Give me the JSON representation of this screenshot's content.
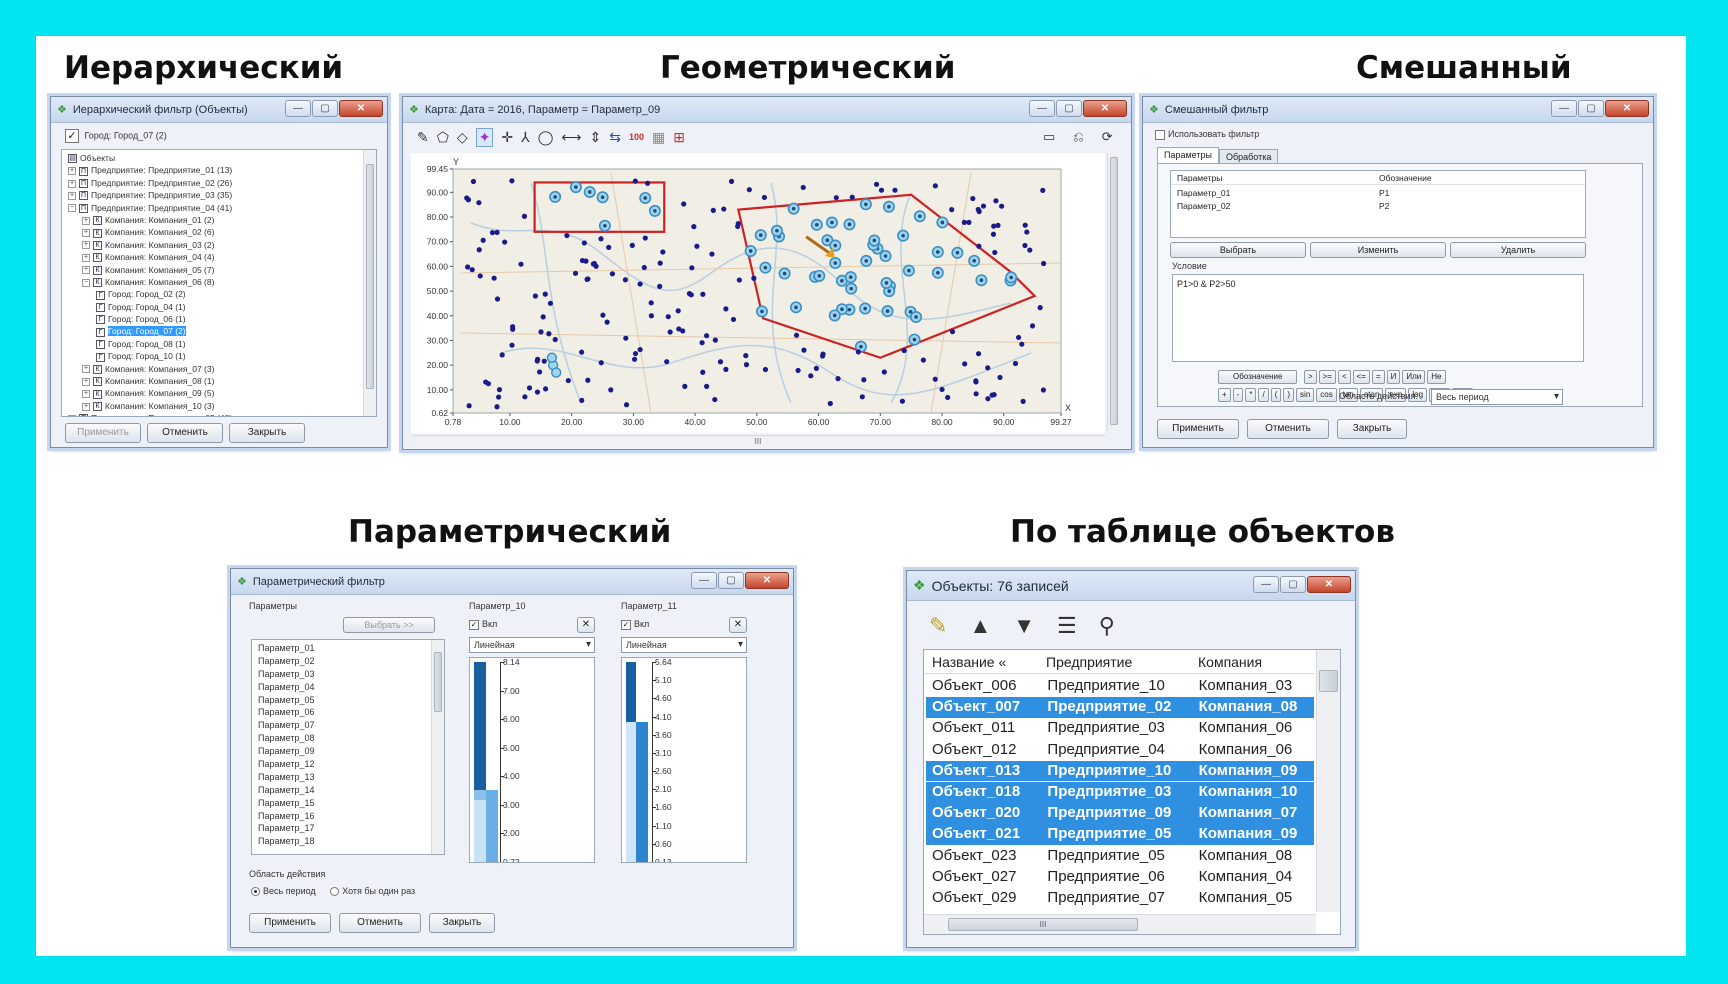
{
  "sections": {
    "hier": "Иерархический",
    "geom": "Геометрический",
    "mixed": "Смешанный",
    "param": "Параметрический",
    "table": "По таблице объектов"
  },
  "window_buttons": {
    "min": "—",
    "max": "▢",
    "close": "✕"
  },
  "hier_window": {
    "title": "Иерархический фильтр (Объекты)",
    "checked_node": "Город: Город_07 (2)",
    "tree": [
      {
        "indent": 0,
        "toggle": "",
        "icon": "▤",
        "label": "Объекты",
        "selected": false
      },
      {
        "indent": 0,
        "toggle": "+",
        "icon": "П",
        "label": "Предприятие: Предприятие_01 (13)",
        "selected": false
      },
      {
        "indent": 0,
        "toggle": "+",
        "icon": "П",
        "label": "Предприятие: Предприятие_02 (26)",
        "selected": false
      },
      {
        "indent": 0,
        "toggle": "+",
        "icon": "П",
        "label": "Предприятие: Предприятие_03 (35)",
        "selected": false
      },
      {
        "indent": 0,
        "toggle": "−",
        "icon": "П",
        "label": "Предприятие: Предприятие_04 (41)",
        "selected": false
      },
      {
        "indent": 1,
        "toggle": "+",
        "icon": "К",
        "label": "Компания: Компания_01 (2)",
        "selected": false
      },
      {
        "indent": 1,
        "toggle": "+",
        "icon": "К",
        "label": "Компания: Компания_02 (6)",
        "selected": false
      },
      {
        "indent": 1,
        "toggle": "+",
        "icon": "К",
        "label": "Компания: Компания_03 (2)",
        "selected": false
      },
      {
        "indent": 1,
        "toggle": "+",
        "icon": "К",
        "label": "Компания: Компания_04 (4)",
        "selected": false
      },
      {
        "indent": 1,
        "toggle": "+",
        "icon": "К",
        "label": "Компания: Компания_05 (7)",
        "selected": false
      },
      {
        "indent": 1,
        "toggle": "−",
        "icon": "К",
        "label": "Компания: Компания_06 (8)",
        "selected": false
      },
      {
        "indent": 2,
        "toggle": "",
        "icon": "Г",
        "label": "Город: Город_02 (2)",
        "selected": false
      },
      {
        "indent": 2,
        "toggle": "",
        "icon": "Г",
        "label": "Город: Город_04 (1)",
        "selected": false
      },
      {
        "indent": 2,
        "toggle": "",
        "icon": "Г",
        "label": "Город: Город_06 (1)",
        "selected": false
      },
      {
        "indent": 2,
        "toggle": "",
        "icon": "Г",
        "label": "Город: Город_07 (2)",
        "selected": true
      },
      {
        "indent": 2,
        "toggle": "",
        "icon": "Г",
        "label": "Город: Город_08 (1)",
        "selected": false
      },
      {
        "indent": 2,
        "toggle": "",
        "icon": "Г",
        "label": "Город: Город_10 (1)",
        "selected": false
      },
      {
        "indent": 1,
        "toggle": "+",
        "icon": "К",
        "label": "Компания: Компания_07 (3)",
        "selected": false
      },
      {
        "indent": 1,
        "toggle": "+",
        "icon": "К",
        "label": "Компания: Компания_08 (1)",
        "selected": false
      },
      {
        "indent": 1,
        "toggle": "+",
        "icon": "К",
        "label": "Компания: Компания_09 (5)",
        "selected": false
      },
      {
        "indent": 1,
        "toggle": "+",
        "icon": "К",
        "label": "Компания: Компания_10 (3)",
        "selected": false
      },
      {
        "indent": 0,
        "toggle": "+",
        "icon": "П",
        "label": "Предприятие: Предприятие_05 (48)",
        "selected": false
      },
      {
        "indent": 0,
        "toggle": "+",
        "icon": "П",
        "label": "Предприятие: Предприятие_06 (38)",
        "selected": false
      },
      {
        "indent": 0,
        "toggle": "+",
        "icon": "П",
        "label": "Предприятие: Предприятие_07 (21)",
        "selected": false
      }
    ],
    "apply": "Применить",
    "cancel": "Отменить",
    "close": "Закрыть"
  },
  "map_window": {
    "title": "Карта: Дата = 2016, Параметр = Параметр_09",
    "y_axis_letter": "Y",
    "x_axis_letter": "X",
    "y_ticks": [
      "99.45",
      "90.00",
      "80.00",
      "70.00",
      "60.00",
      "50.00",
      "40.00",
      "30.00",
      "20.00",
      "10.00",
      "0.62"
    ],
    "x_ticks": [
      "0.78",
      "10.00",
      "20.00",
      "30.00",
      "40.00",
      "50.00",
      "60.00",
      "70.00",
      "80.00",
      "90.00",
      "99.27"
    ],
    "scroll_grip": "III",
    "tools": [
      "✎",
      "⬠",
      "◇",
      "✦",
      "✛",
      "⅄",
      "◯",
      "⟷",
      "⇕",
      "⇆",
      "100",
      "▦",
      "⊞"
    ],
    "tools_right": [
      "▭",
      "⎌",
      "⟳"
    ]
  },
  "mixed_window": {
    "title": "Смешанный фильтр",
    "use_filter": "Использовать фильтр",
    "tabs": [
      "Параметры",
      "Обработка"
    ],
    "col_param": "Параметры",
    "col_symbol": "Обозначение",
    "rows": [
      {
        "name": "Параметр_01",
        "sym": "P1"
      },
      {
        "name": "Параметр_02",
        "sym": "P2"
      }
    ],
    "btn_select": "Выбрать",
    "btn_change": "Изменить",
    "btn_delete": "Удалить",
    "condition_label": "Условие",
    "condition": "P1>0 & P2>50",
    "btn_symbol": "Обозначение",
    "ops_row1": [
      ">",
      ">=",
      "<",
      "<=",
      "=",
      "И",
      "Или",
      "Не"
    ],
    "ops_row2": [
      "+",
      "-",
      "*",
      "/",
      "(",
      ")",
      "sin",
      "cos",
      "tan",
      "atan",
      "exp",
      "log",
      "abs",
      "sqrt"
    ],
    "scope_label": "Область действия:",
    "scope_value": "Весь период",
    "apply": "Применить",
    "cancel": "Отменить",
    "close": "Закрыть"
  },
  "param_window": {
    "title": "Параметрический фильтр",
    "params_label": "Параметры",
    "select_btn": "Выбрать >>",
    "params": [
      "Параметр_01",
      "Параметр_02",
      "Параметр_03",
      "Параметр_04",
      "Параметр_05",
      "Параметр_06",
      "Параметр_07",
      "Параметр_08",
      "Параметр_09",
      "Параметр_12",
      "Параметр_13",
      "Параметр_14",
      "Параметр_15",
      "Параметр_16",
      "Параметр_17",
      "Параметр_18"
    ],
    "col1": {
      "name": "Параметр_10",
      "enabled": "Вкл",
      "scale": "Линейная",
      "ticks": [
        "8.14",
        "7.00",
        "6.00",
        "5.00",
        "4.00",
        "3.00",
        "2.00",
        "0.72"
      ]
    },
    "col2": {
      "name": "Параметр_11",
      "enabled": "Вкл",
      "scale": "Линейная",
      "ticks": [
        "5.64",
        "5.10",
        "4.60",
        "4.10",
        "3.60",
        "3.10",
        "2.60",
        "2.10",
        "1.60",
        "1.10",
        "0.60",
        "0.13"
      ]
    },
    "scope_label": "Область действия",
    "radio1": "Весь период",
    "radio2": "Хотя бы один раз",
    "apply": "Применить",
    "cancel": "Отменить",
    "close": "Закрыть"
  },
  "objects_window": {
    "title": "Объекты: 76 записей",
    "tools": [
      "✎",
      "▲",
      "▼",
      "☰",
      "⚲"
    ],
    "columns": [
      "Название «",
      "Предприятие",
      "Компания"
    ],
    "rows": [
      {
        "name": "Объект_006",
        "ent": "Предприятие_10",
        "comp": "Компания_03",
        "sel": false
      },
      {
        "name": "Объект_007",
        "ent": "Предприятие_02",
        "comp": "Компания_08",
        "sel": true
      },
      {
        "name": "Объект_011",
        "ent": "Предприятие_03",
        "comp": "Компания_06",
        "sel": false
      },
      {
        "name": "Объект_012",
        "ent": "Предприятие_04",
        "comp": "Компания_06",
        "sel": false
      },
      {
        "name": "Объект_013",
        "ent": "Предприятие_10",
        "comp": "Компания_09",
        "sel": true
      },
      {
        "name": "Объект_018",
        "ent": "Предприятие_03",
        "comp": "Компания_10",
        "sel": true
      },
      {
        "name": "Объект_020",
        "ent": "Предприятие_09",
        "comp": "Компания_07",
        "sel": true
      },
      {
        "name": "Объект_021",
        "ent": "Предприятие_05",
        "comp": "Компания_09",
        "sel": true
      },
      {
        "name": "Объект_023",
        "ent": "Предприятие_05",
        "comp": "Компания_08",
        "sel": false
      },
      {
        "name": "Объект_027",
        "ent": "Предприятие_06",
        "comp": "Компания_04",
        "sel": false
      },
      {
        "name": "Объект_029",
        "ent": "Предприятие_07",
        "comp": "Компания_05",
        "sel": false
      }
    ],
    "hscroll_grip": "III"
  },
  "colors": {
    "background": "#00e5ef",
    "selection": "#3399ff",
    "polygon": "#cc2222",
    "point": "#1a1a8a",
    "marker": "#3a8fc0"
  }
}
